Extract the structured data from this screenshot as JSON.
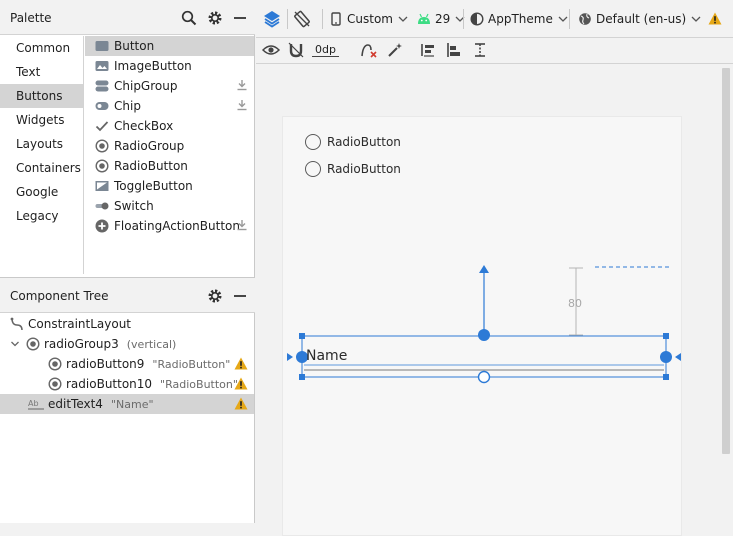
{
  "palette": {
    "title": "Palette",
    "categories": [
      "Common",
      "Text",
      "Buttons",
      "Widgets",
      "Layouts",
      "Containers",
      "Google",
      "Legacy"
    ],
    "selected_category": "Buttons",
    "widgets": [
      {
        "label": "Button",
        "icon": "button-icon"
      },
      {
        "label": "ImageButton",
        "icon": "image-button-icon"
      },
      {
        "label": "ChipGroup",
        "icon": "chip-group-icon",
        "download": true
      },
      {
        "label": "Chip",
        "icon": "chip-icon",
        "download": true
      },
      {
        "label": "CheckBox",
        "icon": "checkbox-icon"
      },
      {
        "label": "RadioGroup",
        "icon": "radio-group-icon"
      },
      {
        "label": "RadioButton",
        "icon": "radio-button-icon"
      },
      {
        "label": "ToggleButton",
        "icon": "toggle-button-icon"
      },
      {
        "label": "Switch",
        "icon": "switch-icon"
      },
      {
        "label": "FloatingActionButton",
        "icon": "fab-icon",
        "download": true
      }
    ],
    "selected_widget": "Button"
  },
  "tree": {
    "title": "Component Tree",
    "nodes": [
      {
        "name": "ConstraintLayout",
        "sub": "",
        "icon": "constraint-layout-icon",
        "warn": false
      },
      {
        "name": "radioGroup3",
        "sub": "(vertical)",
        "icon": "radio-group-icon",
        "warn": false
      },
      {
        "name": "radioButton9",
        "sub": "\"RadioButton\"",
        "icon": "radio-button-icon",
        "warn": true
      },
      {
        "name": "radioButton10",
        "sub": "\"RadioButton\"",
        "icon": "radio-button-icon",
        "warn": true
      },
      {
        "name": "editText4",
        "sub": "\"Name\"",
        "icon": "edit-text-icon",
        "warn": true
      }
    ],
    "selected_node": "editText4"
  },
  "toolbar": {
    "device": "Custom",
    "api_level": "29",
    "theme": "AppTheme",
    "locale": "Default (en-us)",
    "default_margin": "0dp"
  },
  "design": {
    "radio_buttons": [
      "RadioButton",
      "RadioButton"
    ],
    "edit_text_value": "Name",
    "margin_label": "80"
  },
  "colors": {
    "selection_blue": "#2d7ad6",
    "warning_orange": "#e6a817",
    "android_green": "#3ddc84"
  }
}
